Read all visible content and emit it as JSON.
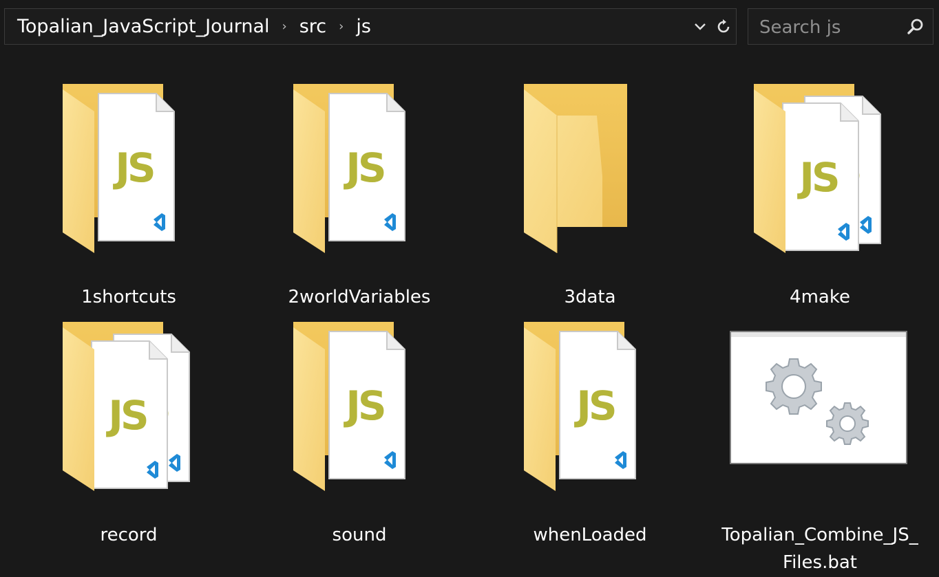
{
  "breadcrumb": {
    "root": "Topalian_JavaScript_Journal",
    "mid": "src",
    "current": "js"
  },
  "address_tools": {
    "dropdown_icon": "chevron-down-icon",
    "refresh_icon": "refresh-icon"
  },
  "search": {
    "placeholder": "Search js",
    "icon": "magnifier-icon"
  },
  "files": [
    {
      "name": "1shortcuts",
      "kind": "folder-js"
    },
    {
      "name": "2worldVariables",
      "kind": "folder-js"
    },
    {
      "name": "3data",
      "kind": "folder-empty"
    },
    {
      "name": "4make",
      "kind": "folder-js-multi"
    },
    {
      "name": "record",
      "kind": "folder-js-multi"
    },
    {
      "name": "sound",
      "kind": "folder-js"
    },
    {
      "name": "whenLoaded",
      "kind": "folder-js"
    },
    {
      "name": "Topalian_Combine_JS_Files.bat",
      "kind": "batch-file"
    }
  ],
  "colors": {
    "background": "#191919",
    "folder": "#f5d47f",
    "js_text": "#b5b53a",
    "vscode_blue": "#1e8ad6"
  }
}
